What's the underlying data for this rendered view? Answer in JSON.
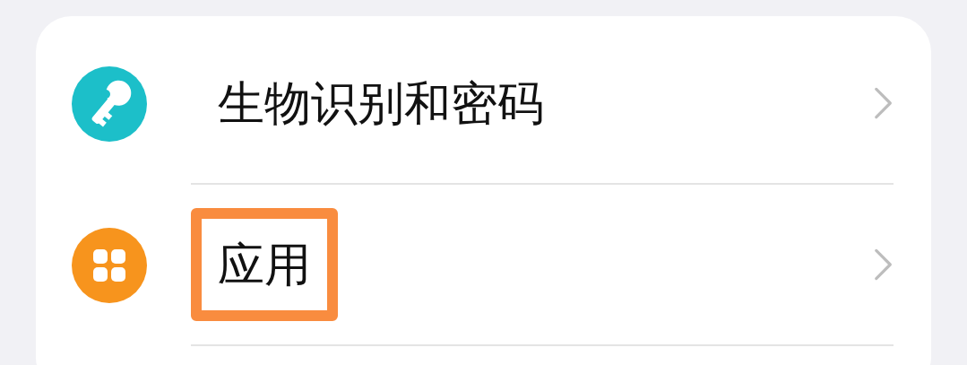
{
  "rows": [
    {
      "label": "生物识别和密码",
      "kind": "key",
      "color": "#1cbfc9",
      "highlighted": false
    },
    {
      "label": "应用",
      "kind": "apps",
      "color": "#f7941d",
      "highlighted": true
    }
  ]
}
